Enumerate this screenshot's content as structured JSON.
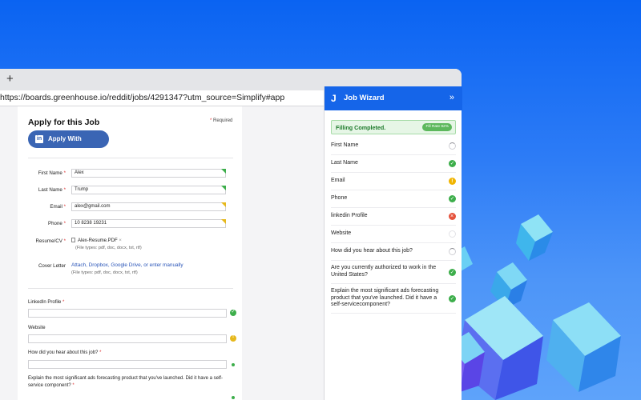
{
  "browser": {
    "new_tab_symbol": "+",
    "url": "https://boards.greenhouse.io/reddit/jobs/4291347?utm_source=Simplify#app"
  },
  "form": {
    "title": "Apply for this Job",
    "required_note": "Required",
    "required_star": "*",
    "linkedin_button": "Apply With LinkedIn",
    "linkedin_icon_text": "in",
    "fields": [
      {
        "label": "First Name",
        "value": "Alex",
        "status": "green"
      },
      {
        "label": "Last Name",
        "value": "Trump",
        "status": "green"
      },
      {
        "label": "Email",
        "value": "alex@gmail.com",
        "status": "yellow"
      },
      {
        "label": "Phone",
        "value": "10 8238 19231",
        "status": "yellow"
      }
    ],
    "resume_label": "Resume/CV",
    "resume_file": "Alex-Resume.PDF",
    "resume_remove": "×",
    "resume_note": "(File types: pdf, doc, docx, txt, rtf)",
    "cover_label": "Cover Letter",
    "cover_links": "Attach, Dropbox, Google Drive, or enter manually",
    "cover_note": "(File types: pdf, doc, docx, txt, rtf)",
    "questions": [
      {
        "label": "LinkedIn Profile",
        "status": "green"
      },
      {
        "label": "Website",
        "status": "yellow"
      },
      {
        "label": "How did you hear about this job?",
        "status": "small-green"
      },
      {
        "label": "Explain the most significant ads forecasting product that you've launched. Did it have a self-service component?",
        "status": "small-green"
      }
    ]
  },
  "wizard": {
    "logo_glyph": "J",
    "title": "Job Wizard",
    "collapse_icon": "»",
    "fill_status": "Filling Completed.",
    "fill_rate": "Fill Rate 92%",
    "items": [
      {
        "label": "First Name",
        "status": "spinner"
      },
      {
        "label": "Last Name",
        "status": "success"
      },
      {
        "label": "Email",
        "status": "warning"
      },
      {
        "label": "Phone",
        "status": "success"
      },
      {
        "label": "linkedin Profile",
        "status": "error"
      },
      {
        "label": "Website",
        "status": "empty"
      },
      {
        "label": "How did you hear about this job?",
        "status": "spinner"
      },
      {
        "label": "Are you currently authorized to work in the United States?",
        "status": "success"
      },
      {
        "label": "Explain the most significant ads forecasting product that you've launched. Did it have a self-servicecomponent?",
        "status": "success"
      }
    ]
  },
  "colors": {
    "background_blue": "#0a63f2",
    "wizard_header": "#1565e9",
    "linkedin_blue": "#3a65b4",
    "success": "#3dae4b",
    "warning": "#f0b400",
    "error": "#e5533d"
  }
}
